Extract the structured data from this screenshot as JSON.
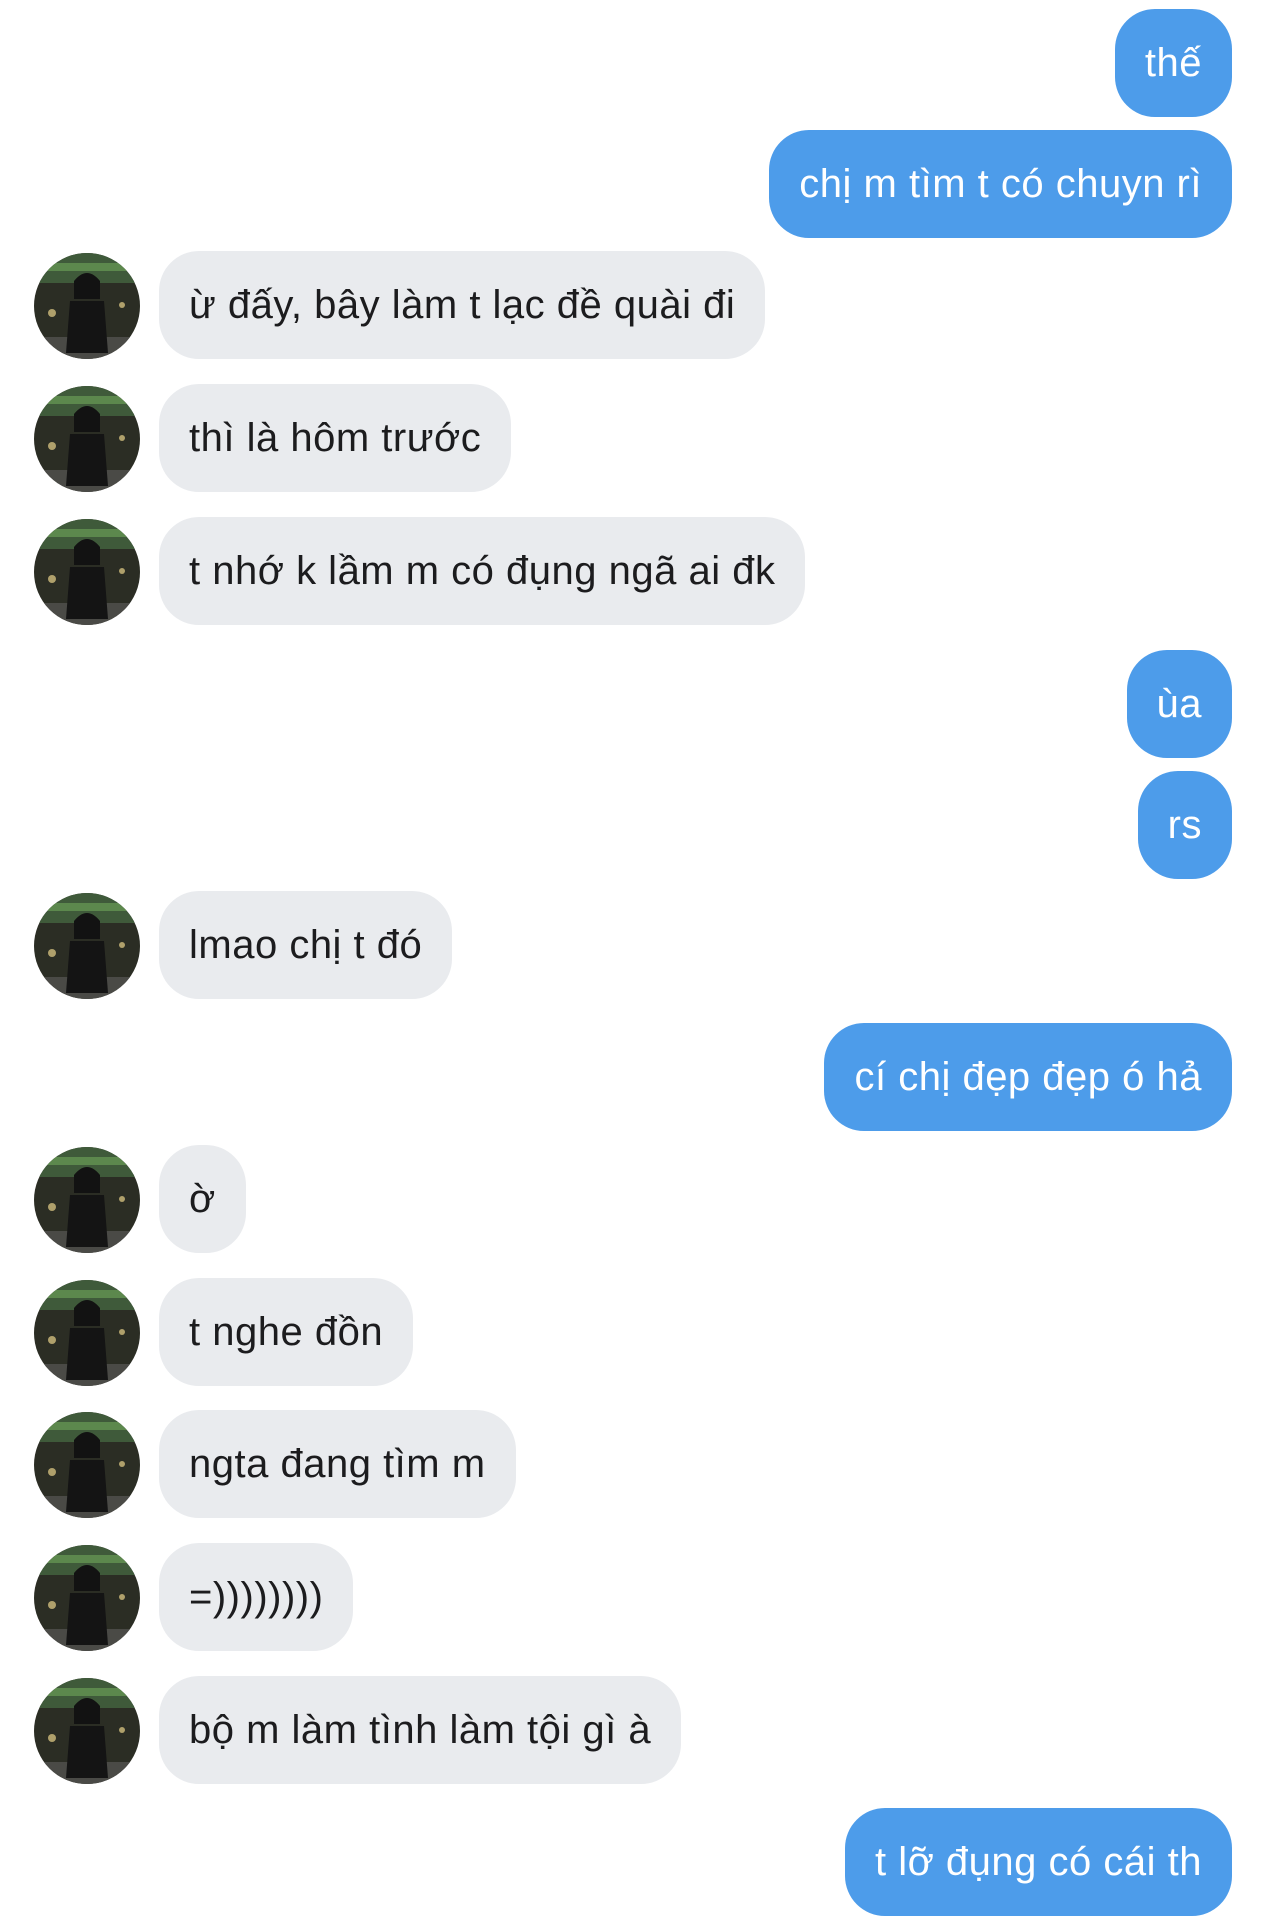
{
  "conversation": {
    "messages": [
      {
        "side": "out",
        "text": "thế"
      },
      {
        "side": "out",
        "text": "chị m tìm t có chuyn rì"
      },
      {
        "side": "in",
        "text": "ừ đấy, bây làm t lạc đề quài đi"
      },
      {
        "side": "in",
        "text": "thì là hôm trước"
      },
      {
        "side": "in",
        "text": "t nhớ k lầm m có đụng ngã ai đk"
      },
      {
        "side": "out",
        "text": "ùa"
      },
      {
        "side": "out",
        "text": "rs"
      },
      {
        "side": "in",
        "text": "lmao chị t đó"
      },
      {
        "side": "out",
        "text": "cí chị đẹp đẹp ó hả"
      },
      {
        "side": "in",
        "text": "ờ"
      },
      {
        "side": "in",
        "text": "t nghe đồn"
      },
      {
        "side": "in",
        "text": "ngta đang tìm m"
      },
      {
        "side": "in",
        "text": "=))))))))"
      },
      {
        "side": "in",
        "text": "bộ m làm tình làm tội gì à"
      },
      {
        "side": "out",
        "text": "t lỡ đụng có cái th"
      }
    ]
  },
  "theme": {
    "outgoing_bubble_color": "#4d9cea",
    "incoming_bubble_color": "#e9ebee",
    "avatar_icon": "contact-avatar-photo"
  }
}
